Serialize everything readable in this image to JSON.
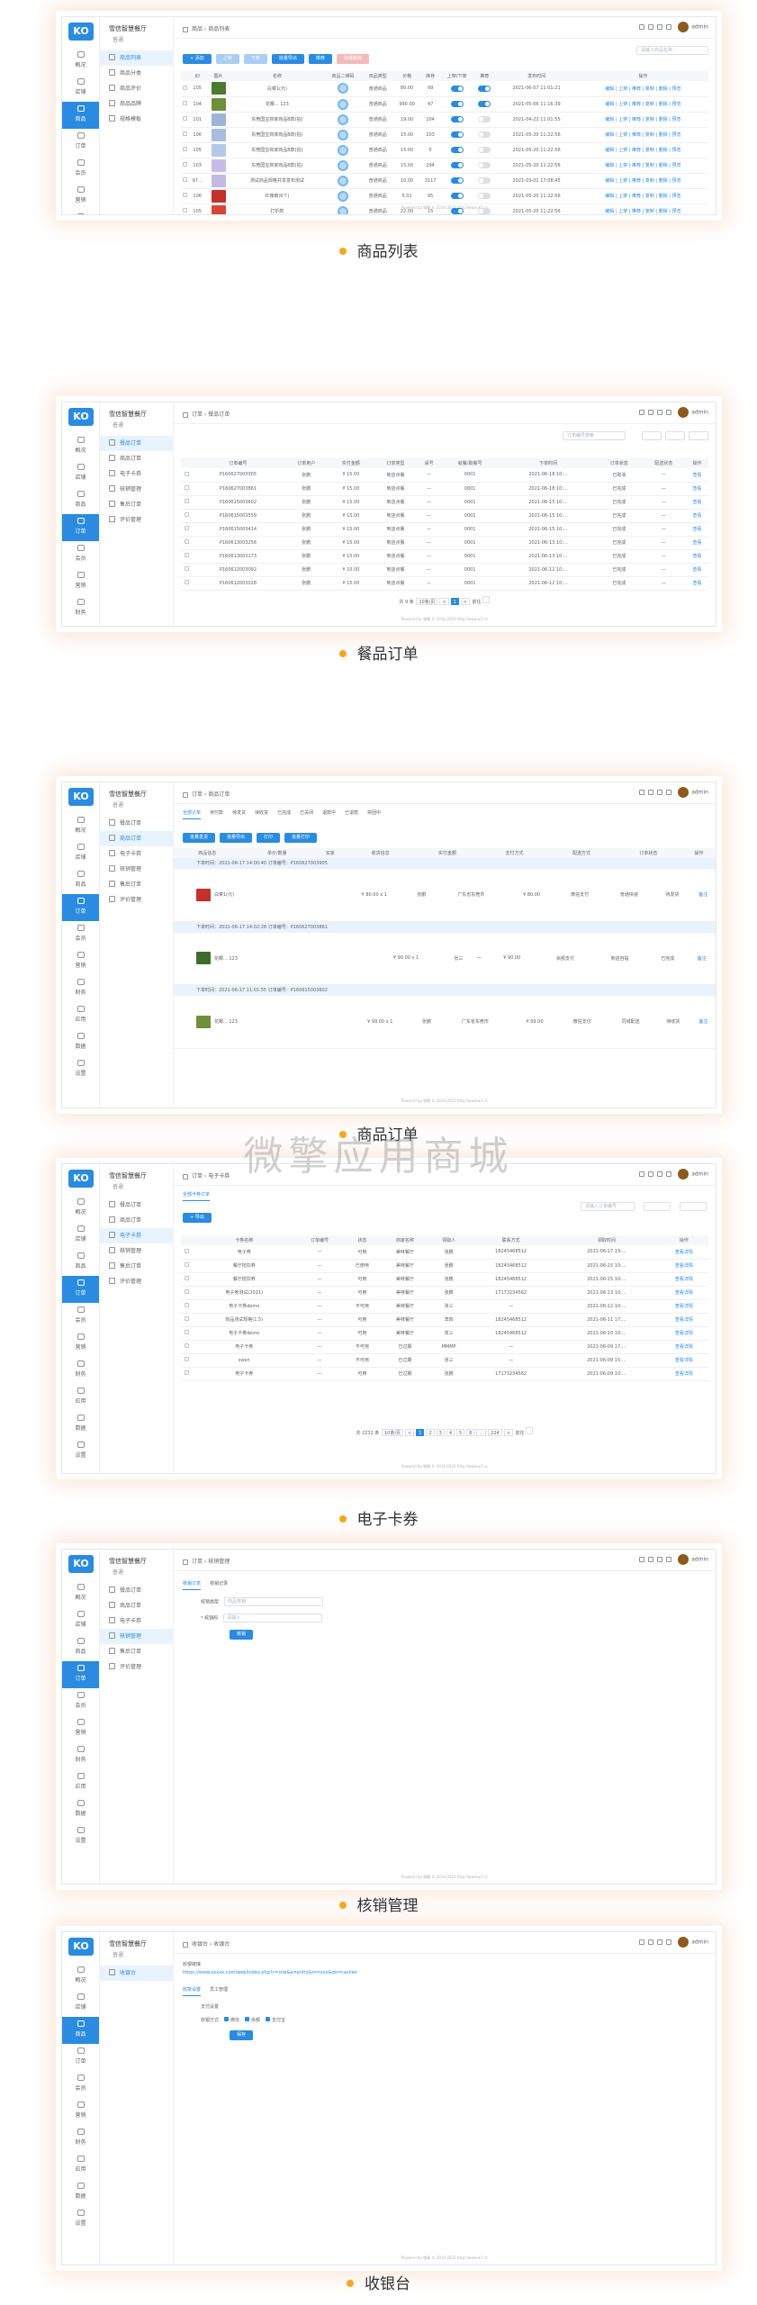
{
  "app": {
    "shop_name": "雪信智慧餐厅",
    "shop_sub": "普通",
    "user": "admin",
    "footer": "Powered by 微擎 © 2014-2023 http://www.w7.cc"
  },
  "nav": [
    "概况",
    "店铺",
    "商品",
    "订单",
    "会员",
    "营销",
    "财务",
    "应用",
    "数据",
    "设置"
  ],
  "watermark": "微擎应用商城",
  "captions": [
    "商品列表",
    "餐品订单",
    "商品订单",
    "电子卡券",
    "核销管理",
    "收银台"
  ],
  "s1": {
    "crumb": "商品 › 商品列表",
    "subnav": [
      "商品列表",
      "商品分类",
      "商品评价",
      "商品品牌",
      "规格模板"
    ],
    "active": 0,
    "buttons": [
      "+ 添加",
      "上架",
      "下架",
      "批量导出",
      "推荐",
      "批量删除"
    ],
    "search_placeholder": "请输入商品名称",
    "headers": [
      "ID",
      "图片",
      "名称",
      "商品二维码",
      "商品类型",
      "价格",
      "库存",
      "上架/下架",
      "推荐",
      "发布时间",
      "操作"
    ],
    "rows": [
      [
        "105",
        "#4c7a2e",
        "白菜1(元)",
        "普通商品",
        "80.00",
        "99",
        "on",
        "on",
        "2021-06-07 11:01:21"
      ],
      [
        "104",
        "#6e8f3c",
        "花椰... 123",
        "普通商品",
        "990.00",
        "47",
        "on",
        "on",
        "2021-05-06 11:16:39"
      ],
      [
        "101",
        "#9bb4d8",
        "东莞国宝商家商品B款(拍)",
        "普通商品",
        "19.00",
        "204",
        "on",
        "off",
        "2021-04-22 11:01:55"
      ],
      [
        "106",
        "#a8bce0",
        "东莞国宝商家商品B款(拍)",
        "普通商品",
        "15.00",
        "203",
        "on",
        "off",
        "2021-05-20 11:22:56"
      ],
      [
        "105",
        "#b4c8e8",
        "东莞国宝商家商品B款(拍)",
        "普通商品",
        "15.00",
        "5",
        "on",
        "off",
        "2021-05-20 11:22:56"
      ],
      [
        "103",
        "#c6bde6",
        "东莞国宝商家商品B款(拍)",
        "普通商品",
        "15.00",
        "294",
        "on",
        "off",
        "2021-05-20 11:22:56"
      ],
      [
        "97...",
        "#c1b9e0",
        "测试商品规格共享发布测试",
        "普通商品",
        "10.00",
        "3117",
        "on",
        "off",
        "2021-03-01 17:08:45"
      ],
      [
        "106",
        "#c4302b",
        "红辣椒(6个)",
        "普通商品",
        "5.01",
        "95",
        "on",
        "off",
        "2021-05-20 11:22:56"
      ],
      [
        "105",
        "#d94535",
        "打折款",
        "普通商品",
        "22.00",
        "15",
        "on",
        "off",
        "2021-05-20 11:22:56"
      ],
      [
        "104",
        "#c8b7e8",
        "打折款",
        "普通商品",
        "4.01",
        "167",
        "on",
        "off",
        "2021-05-20 11:22:56"
      ]
    ],
    "ops": "编辑 | 上架 | 推荐 | 复制 | 删除 | 预览"
  },
  "s2": {
    "crumb": "订单 › 餐品订单",
    "subnav": [
      "餐品订单",
      "商品订单",
      "电子卡券",
      "核销管理",
      "售后订单",
      "评价管理"
    ],
    "active": 0,
    "search_placeholder": "订单编号搜索",
    "headers": [
      "订单编号",
      "订单用户",
      "实付金额",
      "订单类型",
      "桌号",
      "就餐/取餐号",
      "下单时间",
      "订单状态",
      "配送状态",
      "操作"
    ],
    "rows": [
      [
        "P160627003905",
        "张鹏",
        "¥ 15.00",
        "到店点餐",
        "—",
        "0001",
        "2021-06-18 10:...",
        "已取消",
        "—",
        "查看"
      ],
      [
        "P160627003861",
        "张鹏",
        "¥ 15.00",
        "到店点餐",
        "—",
        "0001",
        "2021-06-18 10:...",
        "已完成",
        "—",
        "查看"
      ],
      [
        "P160615003602",
        "张鹏",
        "¥ 15.00",
        "到店点餐",
        "—",
        "0001",
        "2021-06-15 10:...",
        "已完成",
        "—",
        "查看"
      ],
      [
        "P160615003559",
        "张鹏",
        "¥ 15.00",
        "到店点餐",
        "—",
        "0001",
        "2021-06-15 10:...",
        "已完成",
        "—",
        "查看"
      ],
      [
        "P160615003414",
        "张鹏",
        "¥ 15.00",
        "到店点餐",
        "—",
        "0001",
        "2021-06-15 10:...",
        "已完成",
        "—",
        "查看"
      ],
      [
        "P160613003256",
        "张鹏",
        "¥ 15.00",
        "到店点餐",
        "—",
        "0001",
        "2021-06-13 10:...",
        "已完成",
        "—",
        "查看"
      ],
      [
        "P160613003173",
        "张鹏",
        "¥ 15.00",
        "到店点餐",
        "—",
        "0001",
        "2021-06-13 10:...",
        "已完成",
        "—",
        "查看"
      ],
      [
        "P160612003092",
        "张鹏",
        "¥ 10.00",
        "到店点餐",
        "—",
        "0001",
        "2021-06-12 10:...",
        "已完成",
        "—",
        "查看"
      ],
      [
        "P160612003028",
        "张鹏",
        "¥ 15.00",
        "到店点餐",
        "—",
        "0001",
        "2021-06-12 10:...",
        "已完成",
        "—",
        "查看"
      ]
    ],
    "pager_total": "共 9 条",
    "pager_size": "10条/页",
    "pager_pages": [
      "<",
      "1",
      ">"
    ],
    "pager_current": "1",
    "pager_goto": "前往"
  },
  "s3": {
    "crumb": "订单 › 商品订单",
    "subnav": [
      "餐品订单",
      "商品订单",
      "电子卡券",
      "核销管理",
      "售后订单",
      "评价管理"
    ],
    "active": 1,
    "tabs": [
      "全部订单",
      "待付款",
      "待发货",
      "待收货",
      "已完成",
      "已关闭",
      "退款中",
      "已退款",
      "拼团中"
    ],
    "buttons": [
      "批量发货",
      "批量导出",
      "打印",
      "批量打印"
    ],
    "headers": [
      "商品信息",
      "单价/数量",
      "买家",
      "收货信息",
      "实付金额",
      "支付方式",
      "配送方式",
      "订单状态",
      "操作"
    ],
    "groups": [
      {
        "head": "下单时间：2021-06-17 14:00:40  订单编号：P160627003905",
        "name": "白菜1(元)",
        "price": "¥ 80.00 x 1",
        "buyer": "张鹏",
        "addr": "广东省东莞市",
        "amount": "¥ 80.00",
        "pay": "微信支付",
        "ship": "普通快递",
        "status": "待发货",
        "color": "#c4302b"
      },
      {
        "head": "下单时间：2021-06-17 14:02:28  订单编号：P160627003861",
        "name": "花椰... 123",
        "price": "¥ 90.00 x 1",
        "buyer": "张三",
        "addr": "—",
        "amount": "¥ 90.00",
        "pay": "余额支付",
        "ship": "到店自提",
        "status": "已完成",
        "color": "#3c6e2a"
      },
      {
        "head": "下单时间：2021-06-17 11:01:55  订单编号：P160615003602",
        "name": "花椰... 123",
        "price": "¥ 99.00 x 1",
        "buyer": "张鹏",
        "addr": "广东省东莞市",
        "amount": "¥ 99.00",
        "pay": "微信支付",
        "ship": "同城配送",
        "status": "待收货",
        "color": "#6e8f3c"
      }
    ],
    "row_btns": [
      "发货",
      "备注"
    ]
  },
  "s4": {
    "crumb": "订单 › 电子卡券",
    "subnav": [
      "餐品订单",
      "商品订单",
      "电子卡券",
      "核销管理",
      "售后订单",
      "评价管理"
    ],
    "active": 2,
    "tab": "全部卡券订单",
    "button": "+ 导出",
    "search_placeholder": "请输入订单编号",
    "headers": [
      "卡券名称",
      "订单编号",
      "状态",
      "商家名称",
      "领取人",
      "联系方式",
      "领取时间",
      "操作"
    ],
    "rows": [
      [
        "电子券",
        "—",
        "可用",
        "美味餐厅",
        "张鹏",
        "18245468512",
        "2021-06-17 13:...",
        "查看详情"
      ],
      [
        "餐厅抵扣券",
        "—",
        "已使用",
        "美味餐厅",
        "张鹏",
        "18245468512",
        "2021-06-15 10:...",
        "查看详情"
      ],
      [
        "餐厅抵扣券",
        "—",
        "可用",
        "美味餐厅",
        "张鹏",
        "18245468512",
        "2021-06-15 10:...",
        "查看详情"
      ],
      [
        "电子券测试(2021)",
        "—",
        "可用",
        "美味餐厅",
        "张鹏",
        "17173234562",
        "2021-06-13 10:...",
        "查看详情"
      ],
      [
        "电子卡券demo",
        "—",
        "不可用",
        "美味餐厅",
        "张三",
        "—",
        "2021-06-12 10:...",
        "查看详情"
      ],
      [
        "商品测试规格(1.5)",
        "—",
        "可用",
        "美味餐厅",
        "李四",
        "18245468512",
        "2021-06-11 17:...",
        "查看详情"
      ],
      [
        "电子卡券demo",
        "—",
        "可用",
        "美味餐厅",
        "张三",
        "18245468512",
        "2021-06-10 10:...",
        "查看详情"
      ],
      [
        "电子卡券",
        "—",
        "不可用",
        "已过期",
        "MMMP",
        "—",
        "2021-06-09 17:...",
        "查看详情"
      ],
      [
        "swen",
        "—",
        "不可用",
        "已过期",
        "张三",
        "—",
        "2021-06-09 15:...",
        "查看详情"
      ],
      [
        "电子卡券",
        "—",
        "可用",
        "已过期",
        "张鹏",
        "17173234562",
        "2021-06-09 10:...",
        "查看详情"
      ]
    ],
    "pager_total": "共 2232 条",
    "pager_size": "10条/页",
    "pager_pages": [
      "<",
      "1",
      "2",
      "3",
      "4",
      "5",
      "6",
      "...",
      "224",
      ">"
    ],
    "pager_current": "1",
    "pager_goto": "前往"
  },
  "s5": {
    "crumb": "订单 › 核销管理",
    "subnav": [
      "餐品订单",
      "商品订单",
      "电子卡券",
      "核销管理",
      "售后订单",
      "评价管理"
    ],
    "active": 3,
    "tabs": [
      "核销订单",
      "核销记录"
    ],
    "label_type": "核销类型",
    "value_type": "商品核销",
    "label_code": "* 核销码",
    "placeholder_code": "请输入",
    "button": "核销"
  },
  "s6": {
    "crumb": "收银台 › 收银台",
    "subnav": [
      "收银台"
    ],
    "active": 0,
    "link_label": "收银链接",
    "link_url": "https://www.xxxxx.com/web/index.php?c=site&a=entry&m=xxx&do=cashier",
    "tabs": [
      "收款设置",
      "员工管理"
    ],
    "section": "支付设置",
    "label_pay": "收银方式",
    "opts": [
      "微信",
      "余额",
      "支付宝"
    ],
    "button": "保存"
  }
}
